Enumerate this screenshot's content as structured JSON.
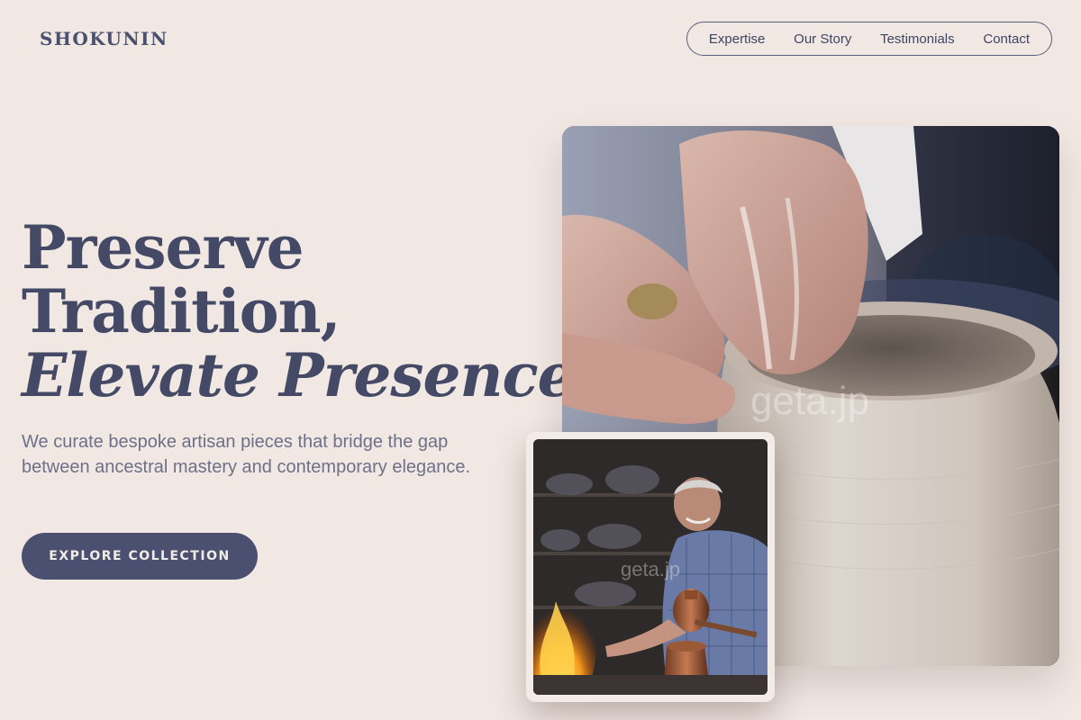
{
  "header": {
    "brand": "SHOKUNIN",
    "nav": [
      "Expertise",
      "Our Story",
      "Testimonials",
      "Contact"
    ]
  },
  "hero": {
    "headline_line1": "Preserve",
    "headline_line2": "Tradition,",
    "headline_line3": "Elevate Presence.",
    "subcopy": "We curate bespoke artisan pieces that bridge the gap between ancestral mastery and contemporary elegance.",
    "cta_label": "EXPLORE COLLECTION"
  },
  "images": {
    "main_alt": "Hands shaping a clay vessel on a pottery wheel",
    "main_watermark": "geta.jp",
    "secondary_alt": "Craftsman working with copper coffee pots over a fire",
    "secondary_watermark": "geta.jp"
  },
  "colors": {
    "background": "#f1e8e4",
    "primary": "#4b5070",
    "text_muted": "#6e7088"
  }
}
